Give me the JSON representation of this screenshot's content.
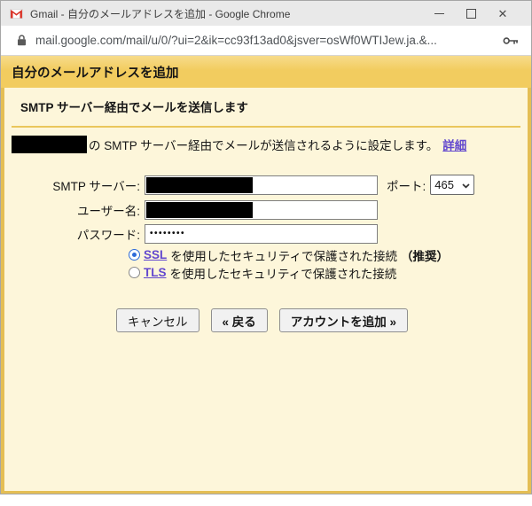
{
  "window": {
    "title": "Gmail - 自分のメールアドレスを追加 - Google Chrome",
    "close_glyph": "✕"
  },
  "address_bar": {
    "url": "mail.google.com/mail/u/0/?ui=2&ik=cc93f13ad0&jsver=osWf0WTIJew.ja.&..."
  },
  "dialog": {
    "header": "自分のメールアドレスを追加",
    "section_title": "SMTP サーバー経由でメールを送信します",
    "intro_text": "の SMTP サーバー経由でメールが送信されるように設定します。",
    "intro_link": "詳細",
    "form": {
      "smtp_label": "SMTP サーバー:",
      "port_label": "ポート:",
      "port_value": "465",
      "username_label": "ユーザー名:",
      "password_label": "パスワード:",
      "password_value": "••••••••",
      "ssl": {
        "link": "SSL",
        "text": "を使用したセキュリティで保護された接続",
        "badge": "（推奨）",
        "selected": true
      },
      "tls": {
        "link": "TLS",
        "text": "を使用したセキュリティで保護された接続",
        "selected": false
      }
    },
    "buttons": {
      "cancel": "キャンセル",
      "back": "« 戻る",
      "add": "アカウントを追加 »"
    }
  },
  "colors": {
    "header_gold": "#F2CC5F",
    "content_cream": "#FDF6DA",
    "border_gold": "#E4BE54",
    "link_purple": "#6247CE",
    "radio_blue": "#2E6BD9",
    "redaction": "#000000",
    "titlebar_gray": "#E9E9E9"
  }
}
